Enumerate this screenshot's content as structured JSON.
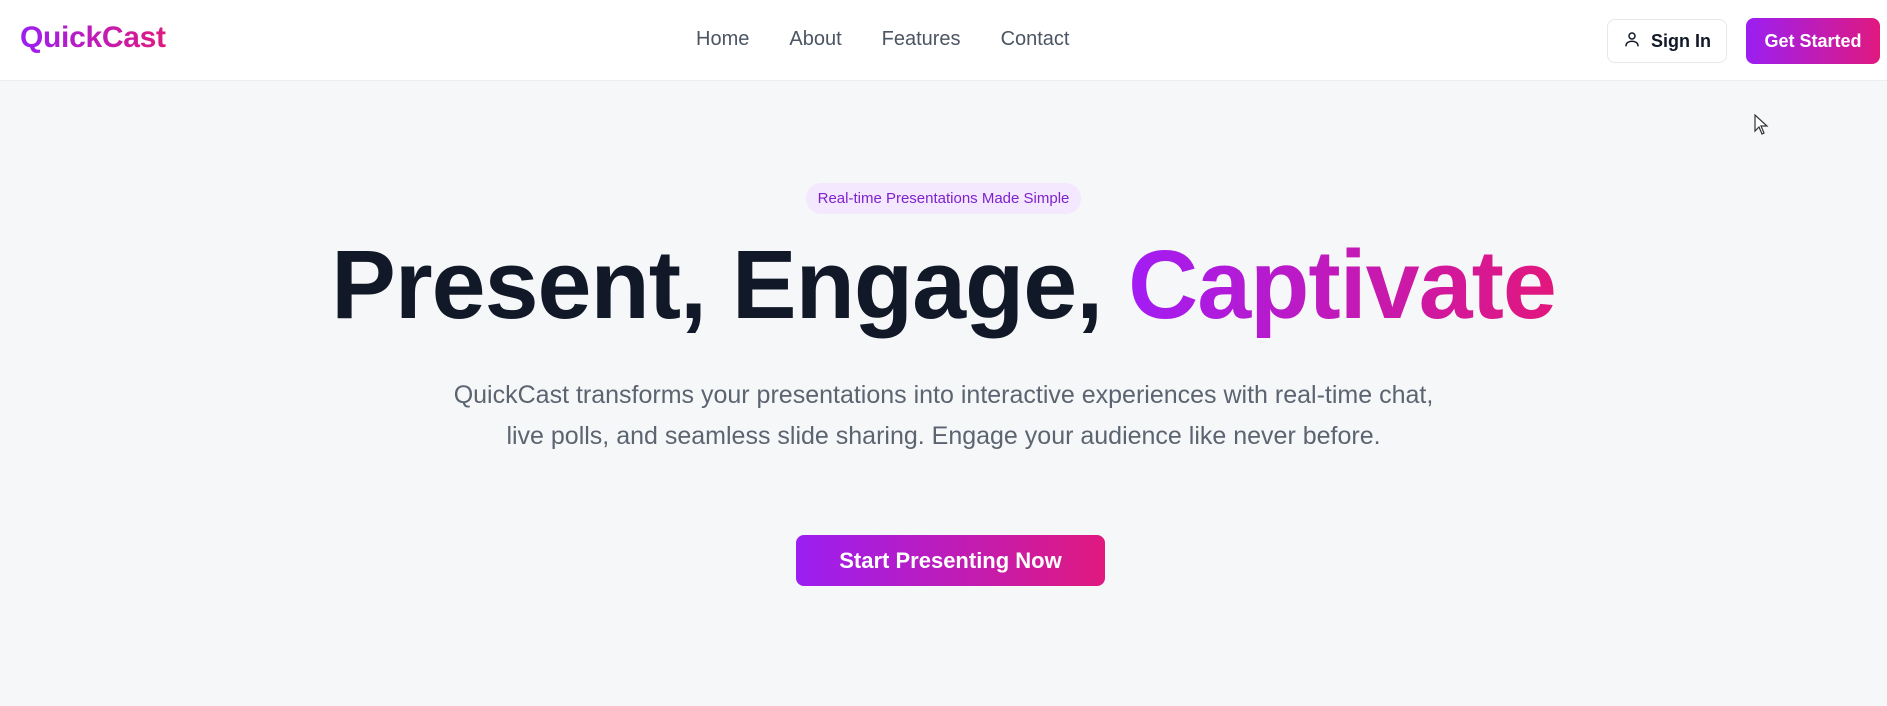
{
  "brand": {
    "name": "QuickCast"
  },
  "nav": {
    "links": [
      "Home",
      "About",
      "Features",
      "Contact"
    ]
  },
  "header": {
    "signin_label": "Sign In",
    "signin_icon": "user-icon",
    "cta_label": "Get Started"
  },
  "hero": {
    "badge": "Real-time Presentations Made Simple",
    "headline_plain": "Present, Engage, ",
    "headline_accent": "Captivate",
    "subtitle": "QuickCast transforms your presentations into interactive experiences with real-time chat, live polls, and seamless slide sharing. Engage your audience like never before.",
    "cta_label": "Start Presenting Now"
  },
  "colors": {
    "gradient_start": "#9b1ff2",
    "gradient_end": "#e0197f",
    "headline": "#111827",
    "badge_bg": "#f3e8fd",
    "badge_text": "#7e22ce"
  }
}
